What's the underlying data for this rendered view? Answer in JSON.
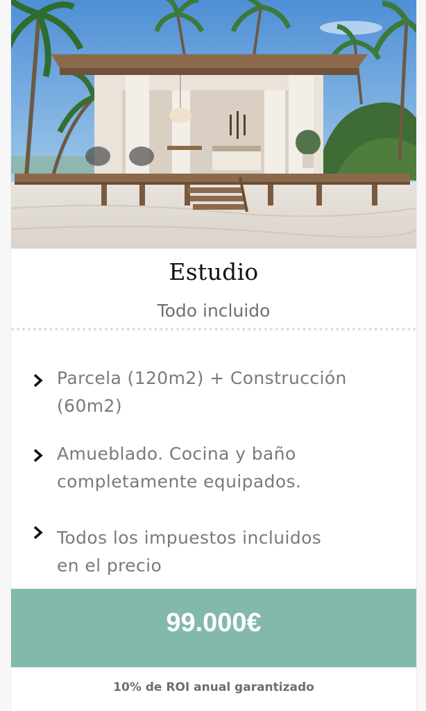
{
  "card": {
    "image_alt_icon": "beach-bungalow-photo",
    "title": "Estudio",
    "subtitle": "Todo incluido",
    "features": [
      {
        "icon": "chevron-right-icon",
        "lines": [
          "Parcela (120m2) + Construcción",
          "(60m2)"
        ]
      },
      {
        "icon": "chevron-right-icon",
        "lines": [
          "Amueblado. Cocina y baño",
          "completamente equipados."
        ]
      },
      {
        "icon": "chevron-right-icon",
        "lines": [
          "Todos los impuestos incluidos",
          "en el precio"
        ]
      }
    ],
    "price": "99.000€",
    "roi_note": "10% de ROI anual garantizado"
  },
  "colors": {
    "accent": "#82b9ac",
    "title": "#111111",
    "muted_text": "#7a7a7a",
    "divider": "#e0ddd2"
  }
}
